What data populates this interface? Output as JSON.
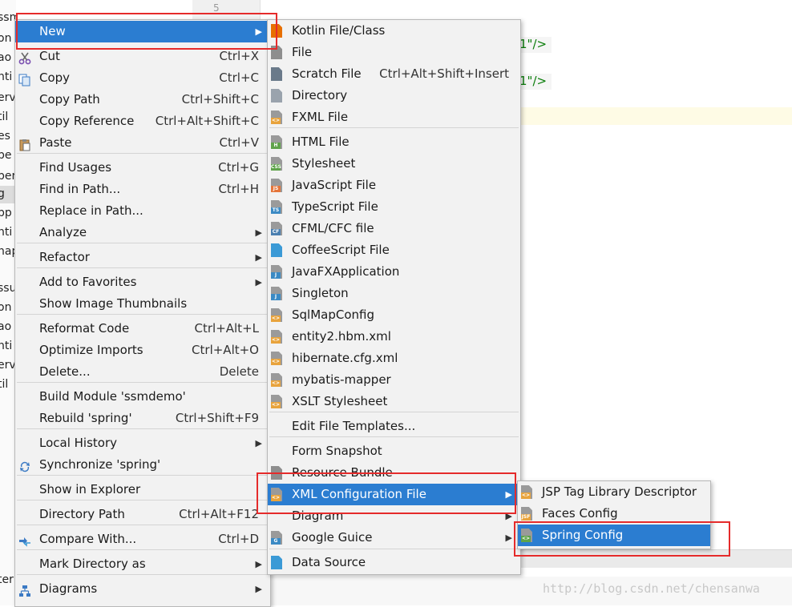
{
  "editor": {
    "line_number": "5",
    "code_fragment": "1\"/>",
    "left_panel_fragments": [
      "ssmdemo",
      "on",
      "ao",
      "nti",
      "erv",
      "til",
      "es",
      "pe",
      "per",
      "g",
      "pp",
      "nti",
      "nap",
      "ssu",
      "on",
      "ao",
      "nti",
      "erv",
      "til",
      "ter"
    ],
    "watermark": "http://blog.csdn.net/chensanwa"
  },
  "context_menu": {
    "items": [
      {
        "label": "New",
        "shortcut": "",
        "submenu": true,
        "icon": "",
        "selected": true
      },
      {
        "label": "Cut",
        "shortcut": "Ctrl+X",
        "icon": "scissors-icon"
      },
      {
        "label": "Copy",
        "shortcut": "Ctrl+C",
        "icon": "copy-icon"
      },
      {
        "label": "Copy Path",
        "shortcut": "Ctrl+Shift+C"
      },
      {
        "label": "Copy Reference",
        "shortcut": "Ctrl+Alt+Shift+C"
      },
      {
        "label": "Paste",
        "shortcut": "Ctrl+V",
        "icon": "paste-icon"
      },
      {
        "label": "Find Usages",
        "shortcut": "Ctrl+G"
      },
      {
        "label": "Find in Path...",
        "shortcut": "Ctrl+H"
      },
      {
        "label": "Replace in Path...",
        "shortcut": ""
      },
      {
        "label": "Analyze",
        "shortcut": "",
        "submenu": true
      },
      {
        "label": "Refactor",
        "shortcut": "",
        "submenu": true
      },
      {
        "label": "Add to Favorites",
        "shortcut": "",
        "submenu": true
      },
      {
        "label": "Show Image Thumbnails",
        "shortcut": ""
      },
      {
        "label": "Reformat Code",
        "shortcut": "Ctrl+Alt+L"
      },
      {
        "label": "Optimize Imports",
        "shortcut": "Ctrl+Alt+O"
      },
      {
        "label": "Delete...",
        "shortcut": "Delete"
      },
      {
        "label": "Build Module 'ssmdemo'",
        "shortcut": ""
      },
      {
        "label": "Rebuild 'spring'",
        "shortcut": "Ctrl+Shift+F9"
      },
      {
        "label": "Local History",
        "shortcut": "",
        "submenu": true
      },
      {
        "label": "Synchronize 'spring'",
        "shortcut": "",
        "icon": "sync-icon"
      },
      {
        "label": "Show in Explorer",
        "shortcut": ""
      },
      {
        "label": "Directory Path",
        "shortcut": "Ctrl+Alt+F12"
      },
      {
        "label": "Compare With...",
        "shortcut": "Ctrl+D",
        "icon": "compare-icon"
      },
      {
        "label": "Mark Directory as",
        "shortcut": "",
        "submenu": true
      },
      {
        "label": "Diagrams",
        "shortcut": "",
        "submenu": true,
        "icon": "diagram-icon"
      }
    ]
  },
  "new_submenu": {
    "items": [
      {
        "label": "Kotlin File/Class",
        "shortcut": "",
        "tag": "",
        "color": "#e76f00"
      },
      {
        "label": "File",
        "shortcut": "",
        "tag": "",
        "color": "#8e8e8e"
      },
      {
        "label": "Scratch File",
        "shortcut": "Ctrl+Alt+Shift+Insert",
        "tag": "",
        "color": "#6a7a8a"
      },
      {
        "label": "Directory",
        "shortcut": "",
        "tag": "",
        "color": "#9aa3ad"
      },
      {
        "label": "FXML File",
        "shortcut": "",
        "tag": "<>",
        "color": "#e8a33c"
      },
      {
        "label": "HTML File",
        "shortcut": "",
        "tag": "H",
        "color": "#5fa34a"
      },
      {
        "label": "Stylesheet",
        "shortcut": "",
        "tag": "CSS",
        "color": "#5fa34a"
      },
      {
        "label": "JavaScript File",
        "shortcut": "",
        "tag": "JS",
        "color": "#e4753a"
      },
      {
        "label": "TypeScript File",
        "shortcut": "",
        "tag": "TS",
        "color": "#3b8ac4"
      },
      {
        "label": "CFML/CFC file",
        "shortcut": "",
        "tag": "CF",
        "color": "#4a7fb0"
      },
      {
        "label": "CoffeeScript File",
        "shortcut": "",
        "tag": "",
        "color": "#3b9ad6"
      },
      {
        "label": "JavaFXApplication",
        "shortcut": "",
        "tag": "J",
        "color": "#3b8ac4"
      },
      {
        "label": "Singleton",
        "shortcut": "",
        "tag": "J",
        "color": "#3b8ac4"
      },
      {
        "label": "SqlMapConfig",
        "shortcut": "",
        "tag": "<>",
        "color": "#e8a33c"
      },
      {
        "label": "entity2.hbm.xml",
        "shortcut": "",
        "tag": "<>",
        "color": "#e8a33c"
      },
      {
        "label": "hibernate.cfg.xml",
        "shortcut": "",
        "tag": "<>",
        "color": "#e8a33c"
      },
      {
        "label": "mybatis-mapper",
        "shortcut": "",
        "tag": "<>",
        "color": "#e8a33c"
      },
      {
        "label": "XSLT Stylesheet",
        "shortcut": "",
        "tag": "<>",
        "color": "#e8a33c"
      },
      {
        "label": "Edit File Templates...",
        "shortcut": "",
        "tag": "",
        "color": ""
      },
      {
        "label": "Form Snapshot",
        "shortcut": "",
        "tag": "",
        "color": ""
      },
      {
        "label": "Resource Bundle",
        "shortcut": "",
        "tag": "",
        "color": "#8e8e8e"
      },
      {
        "label": "XML Configuration File",
        "shortcut": "",
        "submenu": true,
        "selected": true,
        "tag": "<>",
        "color": "#e8a33c"
      },
      {
        "label": "Diagram",
        "shortcut": "",
        "submenu": true,
        "tag": "",
        "color": ""
      },
      {
        "label": "Google Guice",
        "shortcut": "",
        "submenu": true,
        "tag": "G",
        "color": "#3b8ac4"
      },
      {
        "label": "Data Source",
        "shortcut": "",
        "tag": "",
        "color": "#3b9ad6"
      }
    ]
  },
  "xml_submenu": {
    "items": [
      {
        "label": "JSP Tag Library Descriptor",
        "tag": "<>",
        "color": "#e8a33c"
      },
      {
        "label": "Faces Config",
        "tag": "JSF",
        "color": "#e8a33c"
      },
      {
        "label": "Spring Config",
        "tag": "<>",
        "color": "#5fa34a",
        "selected": true
      }
    ]
  }
}
